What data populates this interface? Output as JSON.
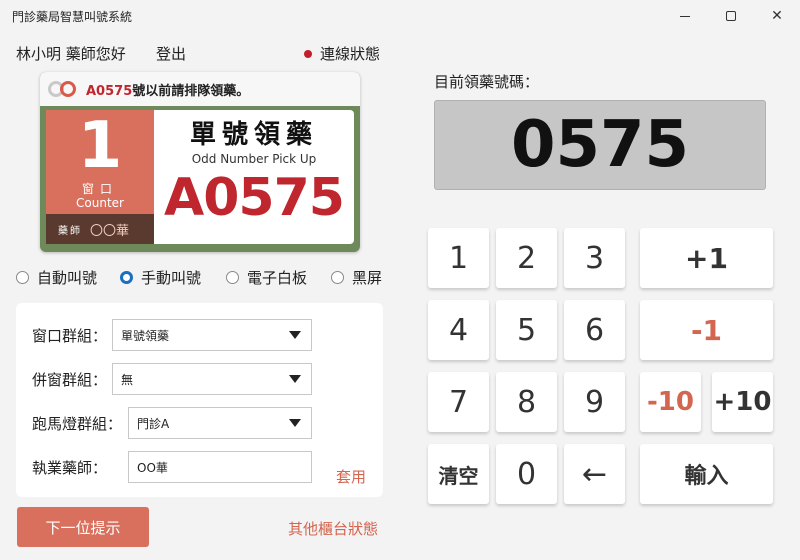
{
  "window": {
    "title": "門診藥局智慧叫號系統"
  },
  "header": {
    "user": "林小明 藥師您好",
    "logout": "登出",
    "connection": "連線狀態"
  },
  "sign": {
    "notice_number": "A0575",
    "notice_text": "號以前請排隊領藥。",
    "window_number": "1",
    "window_label": "窗口",
    "window_label_en": "Counter",
    "pharmacist_label": "藥師",
    "pharmacist_name": "〇〇華",
    "title": "單號領藥",
    "title_en": "Odd Number Pick Up",
    "number": "A0575"
  },
  "modes": [
    {
      "label": "自動叫號",
      "selected": false
    },
    {
      "label": "手動叫號",
      "selected": true
    },
    {
      "label": "電子白板",
      "selected": false
    },
    {
      "label": "黑屏",
      "selected": false
    }
  ],
  "form": {
    "window_group_label": "窗口群組：",
    "window_group_value": "單號領藥",
    "merge_group_label": "併窗群組：",
    "merge_group_value": "無",
    "marquee_group_label": "跑馬燈群組：",
    "marquee_group_value": "門診A",
    "pharmacist_label": "執業藥師：",
    "pharmacist_value": "OO華",
    "apply": "套用"
  },
  "actions": {
    "next_hint": "下一位提示",
    "other_counters": "其他櫃台狀態"
  },
  "current": {
    "label": "目前領藥號碼：",
    "number": "0575"
  },
  "keypad": {
    "k1": "1",
    "k2": "2",
    "k3": "3",
    "k4": "4",
    "k5": "5",
    "k6": "6",
    "k7": "7",
    "k8": "8",
    "k9": "9",
    "k0": "0",
    "clear": "清空",
    "back": "←",
    "plus1": "+1",
    "minus1": "-1",
    "minus10": "-10",
    "plus10": "+10",
    "enter": "輸入"
  },
  "colors": {
    "accent": "#d9705d",
    "danger": "#c0262d",
    "sign_bg": "#6f8a5a",
    "radio_on": "#1a6fbf"
  }
}
